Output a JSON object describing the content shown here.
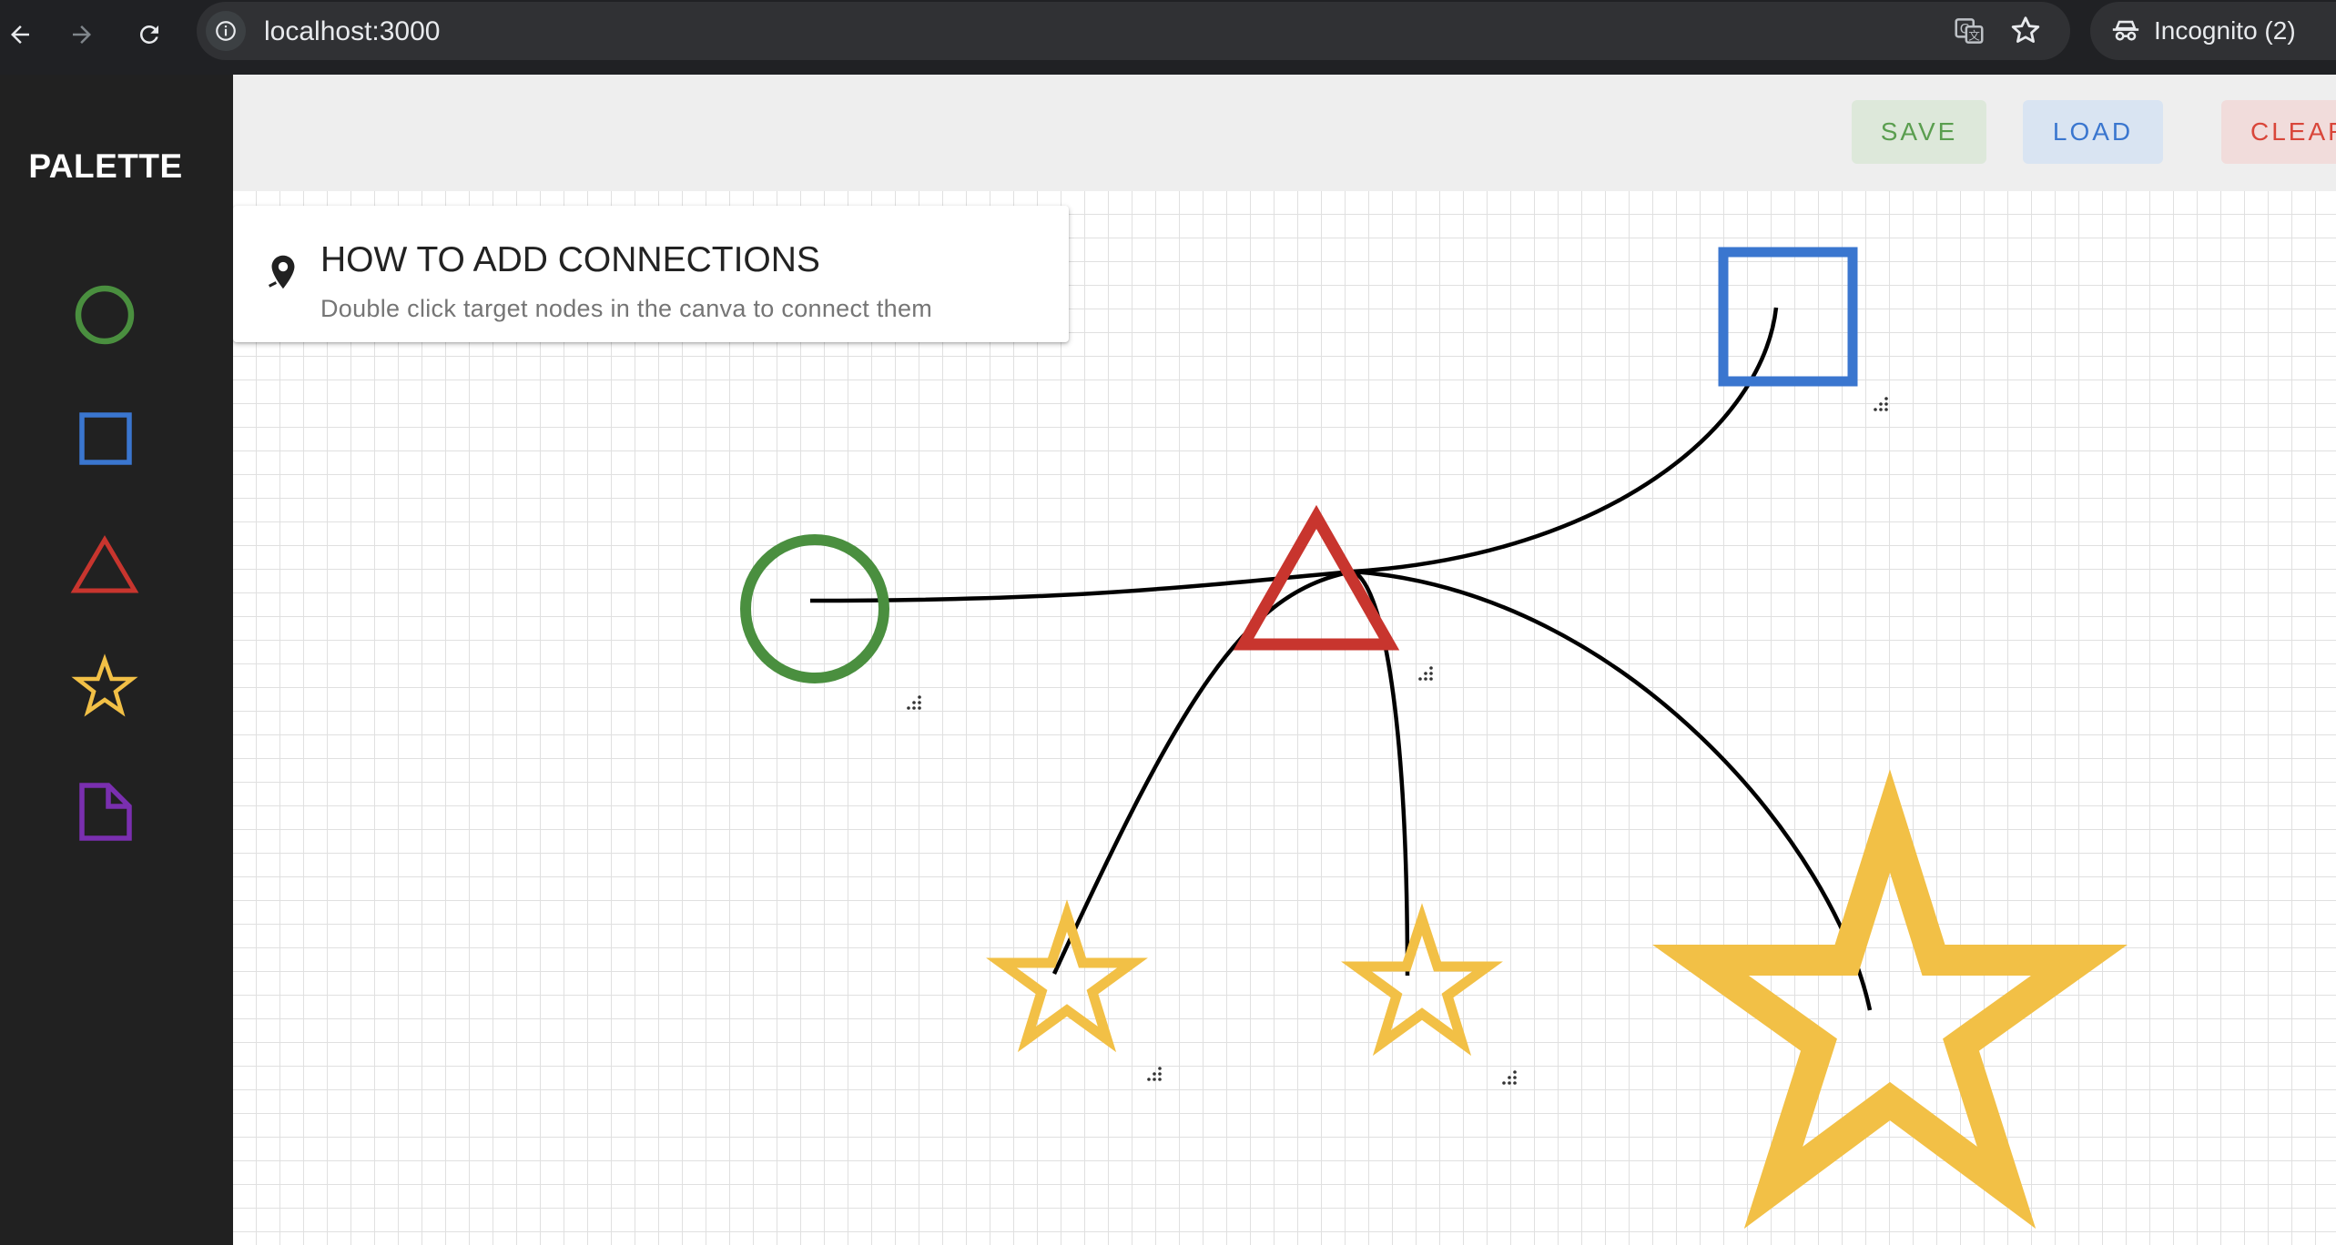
{
  "browser": {
    "url": "localhost:3000",
    "profile_label": "Incognito (2)"
  },
  "sidebar": {
    "title": "PALETTE",
    "items": [
      {
        "name": "circle",
        "color": "#4a8f3f"
      },
      {
        "name": "square",
        "color": "#3a76cf"
      },
      {
        "name": "triangle",
        "color": "#c8352e"
      },
      {
        "name": "star",
        "color": "#f2c046"
      },
      {
        "name": "note",
        "color": "#7a2fb0"
      }
    ]
  },
  "toolbar": {
    "save_label": "SAVE",
    "load_label": "LOAD",
    "clear_label": "CLEAR",
    "save_color": "#5a9e4f",
    "load_color": "#3a76cf",
    "clear_color": "#d9463a"
  },
  "info": {
    "title": "HOW TO ADD CONNECTIONS",
    "text": "Double click target nodes in the canva to connect them",
    "icon": "location-pin-icon"
  },
  "canvas": {
    "nodes": [
      {
        "id": "circle-1",
        "shape": "circle",
        "color": "#4a8f3f"
      },
      {
        "id": "square-1",
        "shape": "square",
        "color": "#3a76cf"
      },
      {
        "id": "triangle-1",
        "shape": "triangle",
        "color": "#c8352e"
      },
      {
        "id": "star-1",
        "shape": "star",
        "color": "#f2c046"
      },
      {
        "id": "star-2",
        "shape": "star",
        "color": "#f2c046"
      },
      {
        "id": "star-3",
        "shape": "star",
        "color": "#f2c046"
      }
    ],
    "connections": [
      {
        "from": "circle-1",
        "to": "triangle-1"
      },
      {
        "from": "triangle-1",
        "to": "square-1"
      },
      {
        "from": "triangle-1",
        "to": "star-1"
      },
      {
        "from": "triangle-1",
        "to": "star-2"
      },
      {
        "from": "triangle-1",
        "to": "star-3"
      }
    ]
  }
}
